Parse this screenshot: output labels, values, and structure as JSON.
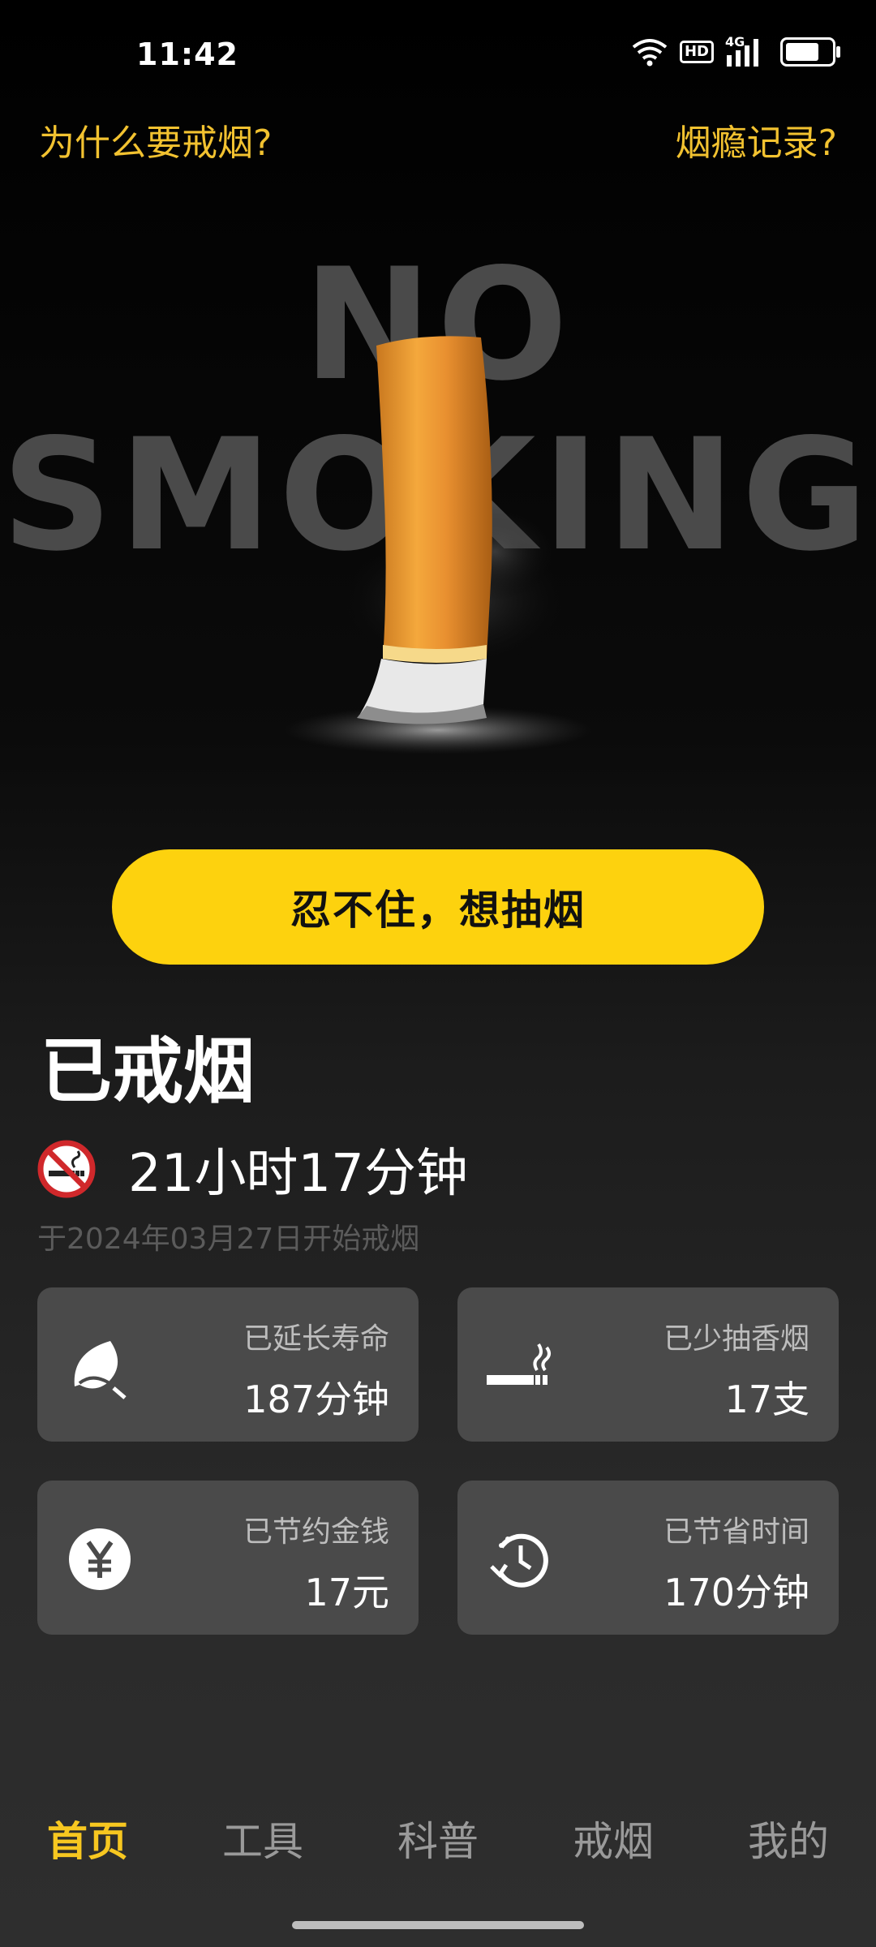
{
  "status_bar": {
    "time": "11:42",
    "network": "4G",
    "hd": "HD"
  },
  "top_links": {
    "left": "为什么要戒烟?",
    "right": "烟瘾记录?"
  },
  "hero": {
    "line1": "NO",
    "line2": "SMOKING"
  },
  "main_button": {
    "label": "忍不住，想抽烟"
  },
  "quit": {
    "title": "已戒烟",
    "duration": "21小时17分钟",
    "start": "于2024年03月27日开始戒烟"
  },
  "stats": [
    {
      "label": "已延长寿命",
      "value": "187分钟",
      "icon": "leaf-icon"
    },
    {
      "label": "已少抽香烟",
      "value": "17支",
      "icon": "cigarette-icon"
    },
    {
      "label": "已节约金钱",
      "value": "17元",
      "icon": "yuan-icon"
    },
    {
      "label": "已节省时间",
      "value": "170分钟",
      "icon": "clock-icon"
    }
  ],
  "tabs": [
    {
      "label": "首页",
      "active": true
    },
    {
      "label": "工具",
      "active": false
    },
    {
      "label": "科普",
      "active": false
    },
    {
      "label": "戒烟",
      "active": false
    },
    {
      "label": "我的",
      "active": false
    }
  ],
  "colors": {
    "accent": "#fdd20e",
    "link": "#f2c230",
    "card": "#4a4a4a"
  }
}
